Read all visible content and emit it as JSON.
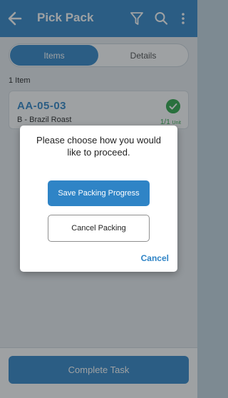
{
  "header": {
    "title": "Pick Pack",
    "back_icon": "arrow-left-icon",
    "filter_icon": "filter-icon",
    "search_icon": "search-icon",
    "more_icon": "more-vertical-icon",
    "color": "#2f84c6"
  },
  "tabs": [
    {
      "label": "Items",
      "active": true
    },
    {
      "label": "Details",
      "active": false
    }
  ],
  "item_count": "1 Item",
  "items": [
    {
      "location": "AA-05-03",
      "product": "B - Brazil Roast",
      "quantity": "1/1",
      "unit": "Unit",
      "status_icon": "check-circle-icon",
      "status_color": "#2aa646"
    }
  ],
  "footer": {
    "complete_label": "Complete Task"
  },
  "dialog": {
    "message": "Please choose how you would like to proceed.",
    "save_label": "Save Packing Progress",
    "cancel_packing_label": "Cancel Packing",
    "cancel_label": "Cancel"
  }
}
